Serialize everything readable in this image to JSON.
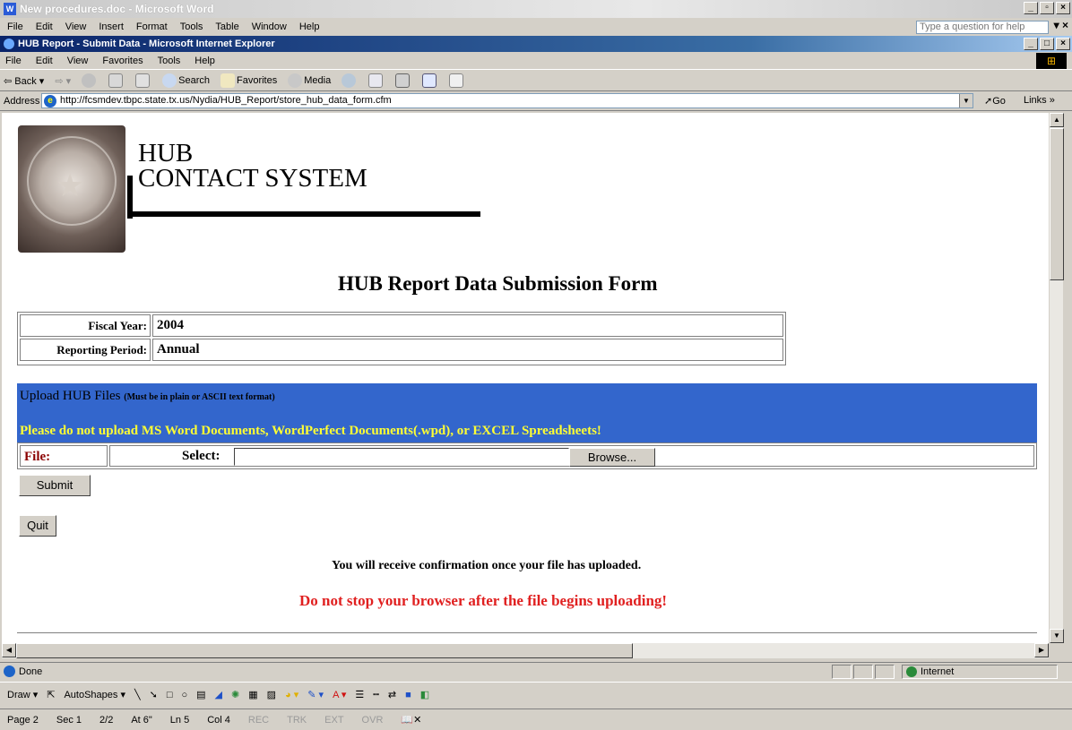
{
  "word": {
    "title": "New procedures.doc - Microsoft Word",
    "menu": [
      "File",
      "Edit",
      "View",
      "Insert",
      "Format",
      "Tools",
      "Table",
      "Window",
      "Help"
    ],
    "help_placeholder": "Type a question for help",
    "status": {
      "page": "Page 2",
      "sec": "Sec 1",
      "pages": "2/2",
      "at": "At 6\"",
      "ln": "Ln 5",
      "col": "Col 4",
      "rec": "REC",
      "trk": "TRK",
      "ext": "EXT",
      "ovr": "OVR"
    },
    "draw": {
      "draw_label": "Draw ▾",
      "autoshapes_label": "AutoShapes ▾"
    }
  },
  "ie": {
    "title": "HUB Report - Submit Data - Microsoft Internet Explorer",
    "menu": [
      "File",
      "Edit",
      "View",
      "Favorites",
      "Tools",
      "Help"
    ],
    "toolbar": {
      "back": "Back",
      "search": "Search",
      "favorites": "Favorites",
      "media": "Media"
    },
    "address_label": "Address",
    "url": "http://fcsmdev.tbpc.state.tx.us/Nydia/HUB_Report/store_hub_data_form.cfm",
    "go": "Go",
    "links": "Links »",
    "status_text": "Done",
    "zone": "Internet"
  },
  "page": {
    "logo_line1": "HUB",
    "logo_line2": "CONTACT SYSTEM",
    "form_title": "HUB Report Data Submission Form",
    "fiscal_year_label": "Fiscal Year:",
    "fiscal_year_value": "2004",
    "reporting_period_label": "Reporting Period:",
    "reporting_period_value": "Annual",
    "upload_title": "Upload HUB Files",
    "upload_note": "(Must be in plain or ASCII text format)",
    "upload_warning": "Please do not upload MS Word Documents, WordPerfect Documents(.wpd), or EXCEL Spreadsheets!",
    "file_label": "File:",
    "select_label": "Select:",
    "file_value": "",
    "browse_label": "Browse...",
    "submit_label": "Submit",
    "quit_label": "Quit",
    "confirm_text": "You will receive confirmation once your file has uploaded.",
    "warn_text": "Do not stop your browser after the file begins uploading!"
  },
  "colors": {
    "upload_bg": "#3366cc",
    "warning_yellow": "#ffff33",
    "warn_red": "#e02020",
    "file_label": "#8b0000"
  }
}
